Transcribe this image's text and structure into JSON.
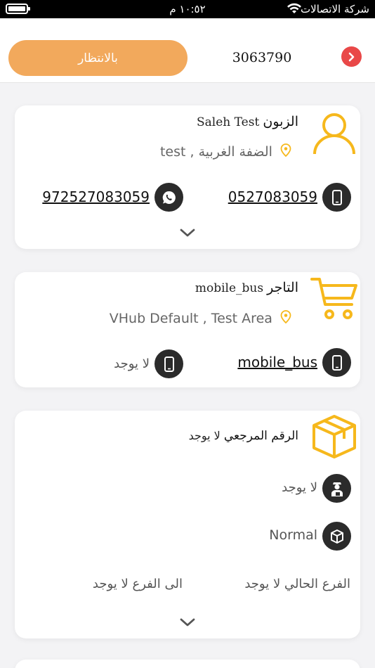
{
  "status_bar": {
    "carrier": "شركة الاتصالات",
    "time": "١٠:٥٢ م"
  },
  "header": {
    "pending_label": "بالانتظار",
    "order_number": "3063790"
  },
  "customer": {
    "title": "الزبون",
    "name": "Saleh Test",
    "address": "الضفة الغربية , test",
    "phone": "0527083059",
    "whatsapp": "972527083059"
  },
  "merchant": {
    "title": "التاجر",
    "name": "mobile_bus",
    "address": "VHub Default , Test Area",
    "phone": "mobile_bus",
    "phone2": "لا يوجد"
  },
  "package": {
    "reference_label": "الرقم المرجعي",
    "reference_value": "لا يوجد",
    "driver": "لا يوجد",
    "type": "Normal",
    "current_branch": "الفرع الحالي لا يوجد",
    "to_branch": "الى الفرع لا يوجد"
  },
  "colors": {
    "accent": "#f2a95c",
    "icon_yellow": "#f6b81c",
    "back_red": "#e94848"
  }
}
